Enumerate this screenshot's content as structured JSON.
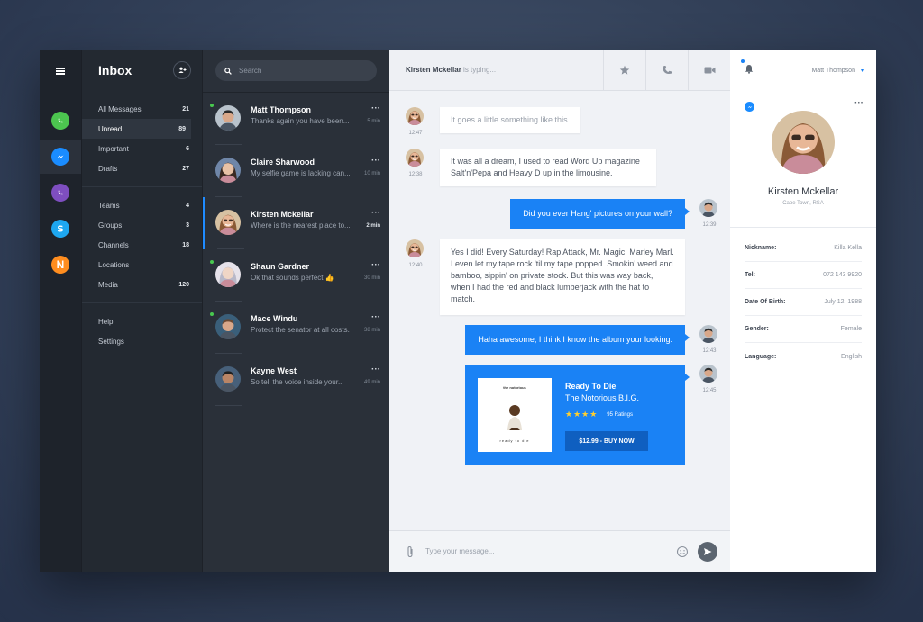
{
  "rail": {
    "apps": [
      {
        "name": "whatsapp",
        "color": "#4cc54f"
      },
      {
        "name": "messenger",
        "color": "#1a8cff"
      },
      {
        "name": "viber",
        "color": "#7e4ec0"
      },
      {
        "name": "skype",
        "color": "#1ea7f0"
      },
      {
        "name": "other-n",
        "color": "#ff8d1f",
        "letter": "N"
      }
    ]
  },
  "folders": {
    "title": "Inbox",
    "groups": [
      [
        {
          "label": "All Messages",
          "count": "21"
        },
        {
          "label": "Unread",
          "count": "89"
        },
        {
          "label": "Important",
          "count": "6"
        },
        {
          "label": "Drafts",
          "count": "27"
        }
      ],
      [
        {
          "label": "Teams",
          "count": "4"
        },
        {
          "label": "Groups",
          "count": "3"
        },
        {
          "label": "Channels",
          "count": "18"
        },
        {
          "label": "Locations",
          "count": ""
        },
        {
          "label": "Media",
          "count": "120"
        }
      ],
      [
        {
          "label": "Help",
          "count": ""
        },
        {
          "label": "Settings",
          "count": ""
        }
      ]
    ]
  },
  "search": {
    "placeholder": "Search"
  },
  "conversations": [
    {
      "name": "Matt Thompson",
      "preview": "Thanks again you have been...",
      "time": "5 min"
    },
    {
      "name": "Claire Sharwood",
      "preview": "My selfie game is lacking can...",
      "time": "10 min"
    },
    {
      "name": "Kirsten Mckellar",
      "preview": "Where is the nearest place to...",
      "time": "2 min"
    },
    {
      "name": "Shaun Gardner",
      "preview": "Ok that sounds perfect",
      "time": "30 min"
    },
    {
      "name": "Mace Windu",
      "preview": "Protect the senator at all costs.",
      "time": "38 min"
    },
    {
      "name": "Kayne West",
      "preview": "So tell the voice inside your...",
      "time": "49 min"
    }
  ],
  "chat": {
    "typing_name": "Kirsten Mckellar",
    "typing_suffix": "is typing...",
    "messages": [
      {
        "text": "It goes a little something like this.",
        "time": "12:47"
      },
      {
        "text": "It was all a dream, I used to read Word Up magazine Salt'n'Pepa and Heavy D up in the limousine.",
        "time": "12:38"
      },
      {
        "text": "Did you ever Hang' pictures on your wall?",
        "time": "12:39"
      },
      {
        "text": "Yes I did! Every Saturday! Rap Attack, Mr. Magic, Marley Marl. I even let my tape rock 'til my tape popped. Smokin' weed and bamboo, sippin' on private stock.  But this was way back, when I had the red and black lumberjack with the hat to match.",
        "time": "12:40"
      },
      {
        "text": "Haha awesome,  I think I know the album your looking.",
        "time": "12:43"
      }
    ],
    "album": {
      "title": "Ready To Die",
      "artist": "The Notorious B.I.G.",
      "stars": "★★★★",
      "ratings": "95 Ratings",
      "buy": "$12.99  -  BUY NOW",
      "time": "12:45",
      "cover_top": "the notorious",
      "cover_bottom": "ready to die"
    },
    "composer_placeholder": "Type your message..."
  },
  "profile": {
    "user": "Matt Thompson",
    "name": "Kirsten Mckellar",
    "location": "Cape Town, RSA",
    "fields": [
      {
        "label": "Nickname:",
        "value": "Killa Kella"
      },
      {
        "label": "Tel:",
        "value": "072 143 9920"
      },
      {
        "label": "Date Of Birth:",
        "value": "July 12, 1988"
      },
      {
        "label": "Gender:",
        "value": "Female"
      },
      {
        "label": "Language:",
        "value": "English"
      }
    ]
  }
}
